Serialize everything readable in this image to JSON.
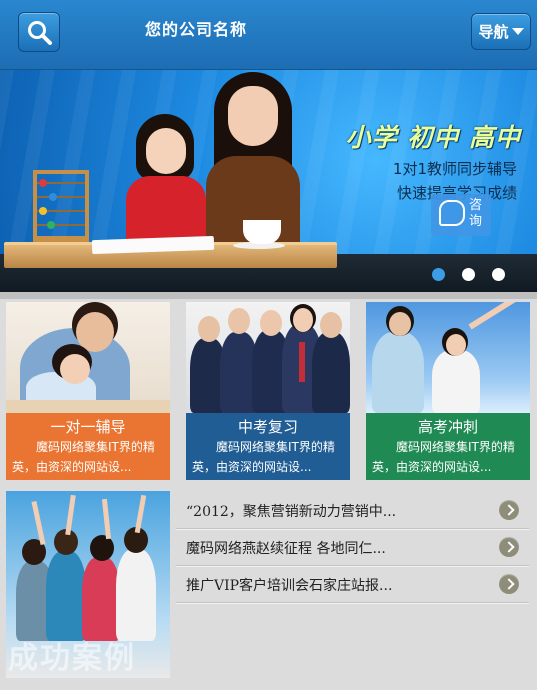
{
  "header": {
    "title": "您的公司名称",
    "nav_label": "导航",
    "search_icon": "search-icon",
    "nav_icon": "caret-down-icon"
  },
  "banner": {
    "headline": "小学 初中 高中",
    "line1": "1对1教师同步辅导",
    "line2": "快速提高学习成绩",
    "consult_label": "咨询",
    "slides_count": 3,
    "active_slide": 1
  },
  "cards": [
    {
      "title": "一对一辅导",
      "desc": "魔码网络聚集IT界的精英，由资深的网站设...",
      "color": "#ea7431"
    },
    {
      "title": "中考复习",
      "desc": "魔码网络聚集IT界的精英，由资深的网站设...",
      "color": "#1f5d94"
    },
    {
      "title": "高考冲刺",
      "desc": "魔码网络聚集IT界的精英，由资深的网站设...",
      "color": "#1f8a53"
    }
  ],
  "case": {
    "label": "成功案例"
  },
  "news": [
    {
      "text": "“2012，聚焦营销新动力营销中..."
    },
    {
      "text": "魔码网络燕赵续征程  各地同仁..."
    },
    {
      "text": "推广VIP客户培训会石家庄站报..."
    }
  ],
  "colors": {
    "header_blue": "#2a87cf",
    "accent_blue": "#3a9de6"
  }
}
